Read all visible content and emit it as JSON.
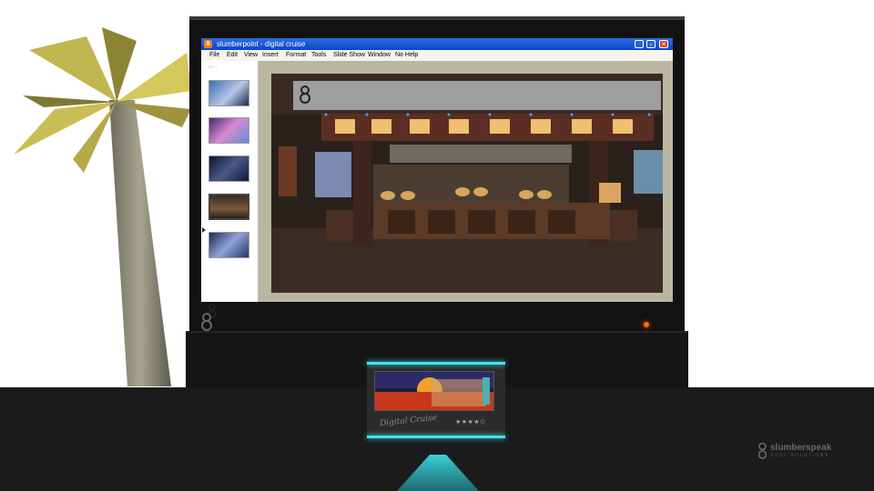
{
  "window": {
    "title": "slumberpoint - digital cruise",
    "app_icon": "8",
    "controls": {
      "minimize": "_",
      "maximize": "▫",
      "close": "✕"
    }
  },
  "menu": {
    "items": [
      "File",
      "Edit",
      "View",
      "Insert",
      "Format",
      "Tools",
      "Slide Show",
      "Window",
      "No Help"
    ]
  },
  "outline": {
    "tabs_label": "▭ ◦",
    "thumbnails": [
      {
        "name": "slide-1",
        "selected": false
      },
      {
        "name": "slide-2",
        "selected": false
      },
      {
        "name": "slide-3",
        "selected": false
      },
      {
        "name": "slide-4",
        "selected": true
      },
      {
        "name": "slide-5",
        "selected": false
      }
    ]
  },
  "dock": {
    "logo_text": "Digital Cruise",
    "rating": "★★★★✩"
  },
  "brand": {
    "name": "slumberspeak",
    "tagline": "SOUL SOLUTIONS"
  },
  "colors": {
    "accent_cyan": "#3fe4ef",
    "titlebar_blue": "#0b45c6",
    "power_led": "#ff6a1a"
  }
}
